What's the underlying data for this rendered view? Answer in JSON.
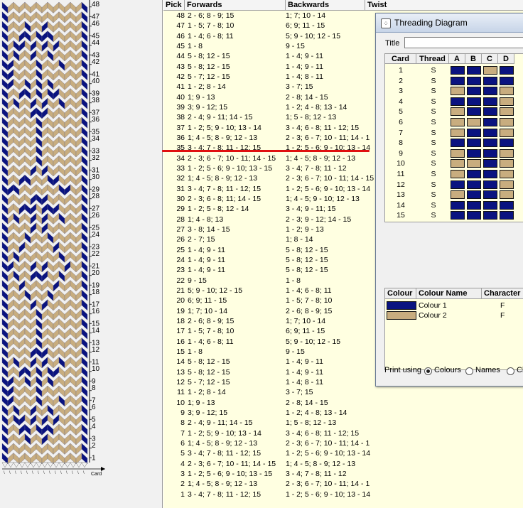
{
  "colors": {
    "thread_dark": "#0a1380",
    "thread_light": "#c8ad7f",
    "table_bg": "#ffffe1",
    "marker": "#e01010"
  },
  "ruler": {
    "numbers": [
      "48",
      "47",
      "46",
      "45",
      "44",
      "43",
      "42",
      "41",
      "40",
      "39",
      "38",
      "37",
      "36",
      "35",
      "34",
      "33",
      "32",
      "31",
      "30",
      "29",
      "28",
      "27",
      "26",
      "25",
      "24",
      "23",
      "22",
      "21",
      "20",
      "19",
      "18",
      "17",
      "16",
      "15",
      "14",
      "13",
      "12",
      "11",
      "10",
      "9",
      "8",
      "7",
      "6",
      "5",
      "4",
      "3",
      "2",
      "1"
    ],
    "bottom_label": "Card"
  },
  "pattern": {
    "columns": 15,
    "grid": [
      "DLLLLLLLLLLLLLD",
      "DLLLLLLLLLLLLLD",
      "DLLLDLLDLLLLLLD",
      "DLLDDLDDDLLLLLD",
      "DLDDLDLDLDLLLLD",
      "DLDLLDLLDLLLLLD",
      "DDLLLLDLLLDLLLD",
      "DDLLLLDLLLLLLLD",
      "DDLLDLDLDLLLLLD",
      "DLLDDLDLDDLLLLD",
      "DLDLLDLDLLDLLLD",
      "DLLLLDDDLLLLLLD",
      "DLLLLLDLLLLLLLD",
      "DLLLLLDLLLLLLLD",
      "DLLLLLDLLLLLLLD",
      "DLLLLLDLLLLLLLD",
      "DLLLLLDLLLLLLLD",
      "DLLLLDLDLLLLLLD",
      "DLLDDLLLDDLLLLD",
      "DDDLLLLLLLDDLLD",
      "DLLLLDDDLLLLLLD",
      "DLLDDDLDDDLLLLD",
      "DLDLLDLDLLDLLLD",
      "DLLLLDLDLLLLLLD",
      "DLLLDLLLDLLLLLD",
      "DLLDLLLLLDLLLLD",
      "DLDLLLLLLLDLLLD",
      "DDLLLDLDLLLDLLD",
      "DLDLLDDDLLDLLLD",
      "DLLDLLLLLDLLLLD",
      "DLLLDLLLDLLLLLD",
      "DLLLLDLDLLLLLLD",
      "DLLLLLDLLLLLLLD",
      "DLLLLLDLLLLLLLD",
      "DLLLLLDLLLLLLLD",
      "DLLLLLDLLLLLLLD",
      "DLLLLDDDLLLLLLD",
      "DLDLLDLDLLDLLLD",
      "DLLDDLDLDDLLLLD",
      "DDLLDLDLDLLLLLD",
      "DDLLLLDLLLLLLLD",
      "DDLLLLDLLLDLLLD",
      "DLDLLDLLDLLLLLD",
      "DLDDLDLDLDLLLLD",
      "DLLDDLDDDLLLLLD",
      "DLLLDLLDLLLLLLD",
      "DLLLLLLLLLLLLLD",
      "DLLLLLLLLLLLLLD"
    ]
  },
  "pick_table": {
    "columns": [
      "Pick",
      "Forwards",
      "Backwards",
      "Twist"
    ],
    "rows": [
      {
        "pick": "48",
        "fwd": "2 - 6; 8 - 9; 15",
        "bwd": "1; 7; 10 - 14"
      },
      {
        "pick": "47",
        "fwd": "1 - 5; 7 - 8; 10",
        "bwd": "6; 9; 11 - 15"
      },
      {
        "pick": "46",
        "fwd": "1 - 4; 6 - 8; 11",
        "bwd": "5; 9 - 10; 12 - 15"
      },
      {
        "pick": "45",
        "fwd": "1 - 8",
        "bwd": "9 - 15"
      },
      {
        "pick": "44",
        "fwd": "5 - 8; 12 - 15",
        "bwd": "1 - 4; 9 - 11"
      },
      {
        "pick": "43",
        "fwd": "5 - 8; 12 - 15",
        "bwd": "1 - 4; 9 - 11"
      },
      {
        "pick": "42",
        "fwd": "5 - 7; 12 - 15",
        "bwd": "1 - 4; 8 - 11"
      },
      {
        "pick": "41",
        "fwd": "1 - 2; 8 - 14",
        "bwd": "3 - 7; 15"
      },
      {
        "pick": "40",
        "fwd": "1; 9 - 13",
        "bwd": "2 - 8; 14 - 15"
      },
      {
        "pick": "39",
        "fwd": "3; 9 - 12; 15",
        "bwd": "1 - 2; 4 - 8; 13 - 14"
      },
      {
        "pick": "38",
        "fwd": "2 - 4; 9 - 11; 14 - 15",
        "bwd": "1; 5 - 8; 12 - 13"
      },
      {
        "pick": "37",
        "fwd": "1 - 2; 5; 9 - 10; 13 - 14",
        "bwd": "3 - 4; 6 - 8; 11 - 12; 15"
      },
      {
        "pick": "36",
        "fwd": "1; 4 - 5; 8 - 9; 12 - 13",
        "bwd": "2 - 3; 6 - 7; 10 - 11; 14 - 1"
      },
      {
        "pick": "35",
        "fwd": "3 - 4; 7 - 8; 11 - 12; 15",
        "bwd": "1 - 2; 5 - 6; 9 - 10; 13 - 14"
      },
      {
        "pick": "34",
        "fwd": "2 - 3; 6 - 7; 10 - 11; 14 - 15",
        "bwd": "1; 4 - 5; 8 - 9; 12 - 13"
      },
      {
        "pick": "33",
        "fwd": "1 - 2; 5 - 6; 9 - 10; 13 - 15",
        "bwd": "3 - 4; 7 - 8; 11 - 12"
      },
      {
        "pick": "32",
        "fwd": "1; 4 - 5; 8 - 9; 12 - 13",
        "bwd": "2 - 3; 6 - 7; 10 - 11; 14 - 15"
      },
      {
        "pick": "31",
        "fwd": "3 - 4; 7 - 8; 11 - 12; 15",
        "bwd": "1 - 2; 5 - 6; 9 - 10; 13 - 14"
      },
      {
        "pick": "30",
        "fwd": "2 - 3; 6 - 8; 11; 14 - 15",
        "bwd": "1; 4 - 5; 9 - 10; 12 - 13"
      },
      {
        "pick": "29",
        "fwd": "1 - 2; 5 - 8; 12 - 14",
        "bwd": "3 - 4; 9 - 11; 15"
      },
      {
        "pick": "28",
        "fwd": "1; 4 - 8; 13",
        "bwd": "2 - 3; 9 - 12; 14 - 15"
      },
      {
        "pick": "27",
        "fwd": "3 - 8; 14 - 15",
        "bwd": "1 - 2; 9 - 13"
      },
      {
        "pick": "26",
        "fwd": "2 - 7; 15",
        "bwd": "1; 8 - 14"
      },
      {
        "pick": "25",
        "fwd": "1 - 4; 9 - 11",
        "bwd": "5 - 8; 12 - 15"
      },
      {
        "pick": "24",
        "fwd": "1 - 4; 9 - 11",
        "bwd": "5 - 8; 12 - 15"
      },
      {
        "pick": "23",
        "fwd": "1 - 4; 9 - 11",
        "bwd": "5 - 8; 12 - 15"
      },
      {
        "pick": "22",
        "fwd": "9 - 15",
        "bwd": "1 - 8"
      },
      {
        "pick": "21",
        "fwd": "5; 9 - 10; 12 - 15",
        "bwd": "1 - 4; 6 - 8; 11"
      },
      {
        "pick": "20",
        "fwd": "6; 9; 11 - 15",
        "bwd": "1 - 5; 7 - 8; 10"
      },
      {
        "pick": "19",
        "fwd": "1; 7; 10 - 14",
        "bwd": "2 - 6; 8 - 9; 15"
      },
      {
        "pick": "18",
        "fwd": "2 - 6; 8 - 9; 15",
        "bwd": "1; 7; 10 - 14"
      },
      {
        "pick": "17",
        "fwd": "1 - 5; 7 - 8; 10",
        "bwd": "6; 9; 11 - 15"
      },
      {
        "pick": "16",
        "fwd": "1 - 4; 6 - 8; 11",
        "bwd": "5; 9 - 10; 12 - 15"
      },
      {
        "pick": "15",
        "fwd": "1 - 8",
        "bwd": "9 - 15"
      },
      {
        "pick": "14",
        "fwd": "5 - 8; 12 - 15",
        "bwd": "1 - 4; 9 - 11"
      },
      {
        "pick": "13",
        "fwd": "5 - 8; 12 - 15",
        "bwd": "1 - 4; 9 - 11"
      },
      {
        "pick": "12",
        "fwd": "5 - 7; 12 - 15",
        "bwd": "1 - 4; 8 - 11"
      },
      {
        "pick": "11",
        "fwd": "1 - 2; 8 - 14",
        "bwd": "3 - 7; 15"
      },
      {
        "pick": "10",
        "fwd": "1; 9 - 13",
        "bwd": "2 - 8; 14 - 15"
      },
      {
        "pick": "9",
        "fwd": "3; 9 - 12; 15",
        "bwd": "1 - 2; 4 - 8; 13 - 14"
      },
      {
        "pick": "8",
        "fwd": "2 - 4; 9 - 11; 14 - 15",
        "bwd": "1; 5 - 8; 12 - 13"
      },
      {
        "pick": "7",
        "fwd": "1 - 2; 5; 9 - 10; 13 - 14",
        "bwd": "3 - 4; 6 - 8; 11 - 12; 15"
      },
      {
        "pick": "6",
        "fwd": "1; 4 - 5; 8 - 9; 12 - 13",
        "bwd": "2 - 3; 6 - 7; 10 - 11; 14 - 1"
      },
      {
        "pick": "5",
        "fwd": "3 - 4; 7 - 8; 11 - 12; 15",
        "bwd": "1 - 2; 5 - 6; 9 - 10; 13 - 14"
      },
      {
        "pick": "4",
        "fwd": "2 - 3; 6 - 7; 10 - 11; 14 - 15",
        "bwd": "1; 4 - 5; 8 - 9; 12 - 13"
      },
      {
        "pick": "3",
        "fwd": "1 - 2; 5 - 6; 9 - 10; 13 - 15",
        "bwd": "3 - 4; 7 - 8; 11 - 12"
      },
      {
        "pick": "2",
        "fwd": "1; 4 - 5; 8 - 9; 12 - 13",
        "bwd": "2 - 3; 6 - 7; 10 - 11; 14 - 1"
      },
      {
        "pick": "1",
        "fwd": "3 - 4; 7 - 8; 11 - 12; 15",
        "bwd": "1 - 2; 5 - 6; 9 - 10; 13 - 14"
      }
    ]
  },
  "threading_window": {
    "title": "Threading Diagram",
    "title_label": "Title",
    "title_value": "",
    "card_columns": [
      "Card",
      "Thread",
      "A",
      "B",
      "C",
      "D"
    ],
    "cards": [
      {
        "card": "1",
        "thread": "S",
        "holes": "DDLD"
      },
      {
        "card": "2",
        "thread": "S",
        "holes": "DDDD"
      },
      {
        "card": "3",
        "thread": "S",
        "holes": "LDDL"
      },
      {
        "card": "4",
        "thread": "S",
        "holes": "DDDL"
      },
      {
        "card": "5",
        "thread": "S",
        "holes": "LDDL"
      },
      {
        "card": "6",
        "thread": "S",
        "holes": "LLDL"
      },
      {
        "card": "7",
        "thread": "S",
        "holes": "LDDL"
      },
      {
        "card": "8",
        "thread": "S",
        "holes": "DDDD"
      },
      {
        "card": "9",
        "thread": "S",
        "holes": "LDDL"
      },
      {
        "card": "10",
        "thread": "S",
        "holes": "LLDL"
      },
      {
        "card": "11",
        "thread": "S",
        "holes": "LDDL"
      },
      {
        "card": "12",
        "thread": "S",
        "holes": "DDDL"
      },
      {
        "card": "13",
        "thread": "S",
        "holes": "LDDL"
      },
      {
        "card": "14",
        "thread": "S",
        "holes": "DDDD"
      },
      {
        "card": "15",
        "thread": "S",
        "holes": "DDDD"
      }
    ],
    "colour_columns": [
      "Colour",
      "Colour Name",
      "Character"
    ],
    "colours": [
      {
        "name": "Colour 1",
        "character": "F",
        "hex": "#0a1380"
      },
      {
        "name": "Colour 2",
        "character": "F",
        "hex": "#c8ad7f"
      }
    ],
    "print_using": {
      "label": "Print using",
      "options": [
        "Colours",
        "Names",
        "Ch"
      ],
      "selected": "Colours"
    }
  }
}
